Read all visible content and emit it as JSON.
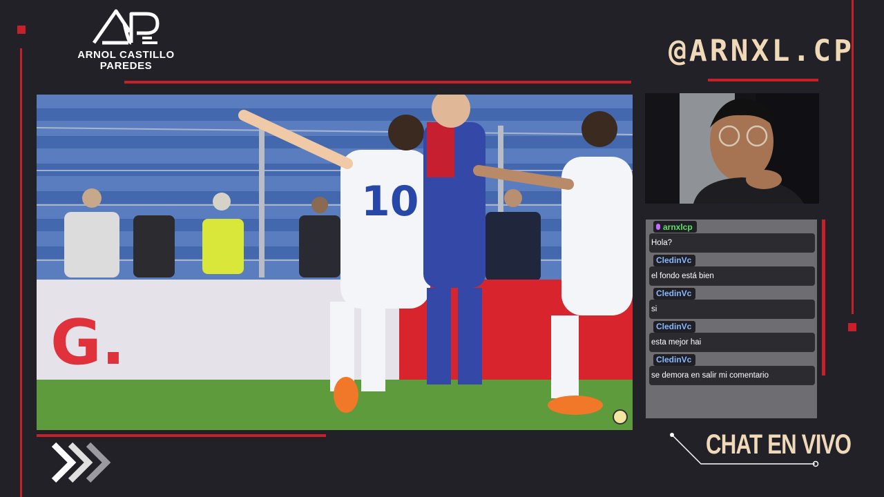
{
  "brand": {
    "logo_line1": "ARNOL CASTILLO",
    "logo_line2": "PAREDES",
    "handle": "@ARNXL.CP"
  },
  "chat": {
    "title": "CHAT EN VIVO",
    "messages": [
      {
        "user": "arnxlcp",
        "text": "Hola?"
      },
      {
        "user": "CledinVc",
        "text": "el fondo está bien"
      },
      {
        "user": "CledinVc",
        "text": "si"
      },
      {
        "user": "CledinVc",
        "text": "esta mejor hai"
      },
      {
        "user": "CledinVc",
        "text": "se demora en salir mi comentario"
      }
    ]
  },
  "colors": {
    "background": "#222127",
    "accent_red": "#c8202a",
    "cream": "#f0d9b8",
    "chat_panel": "#6e6e72",
    "user_green": "#5fe06c",
    "user_blue": "#8ab8ff"
  },
  "icons": {
    "broadcaster_badge": "mic-icon",
    "arrows": "triple-chevron-right-icon"
  }
}
